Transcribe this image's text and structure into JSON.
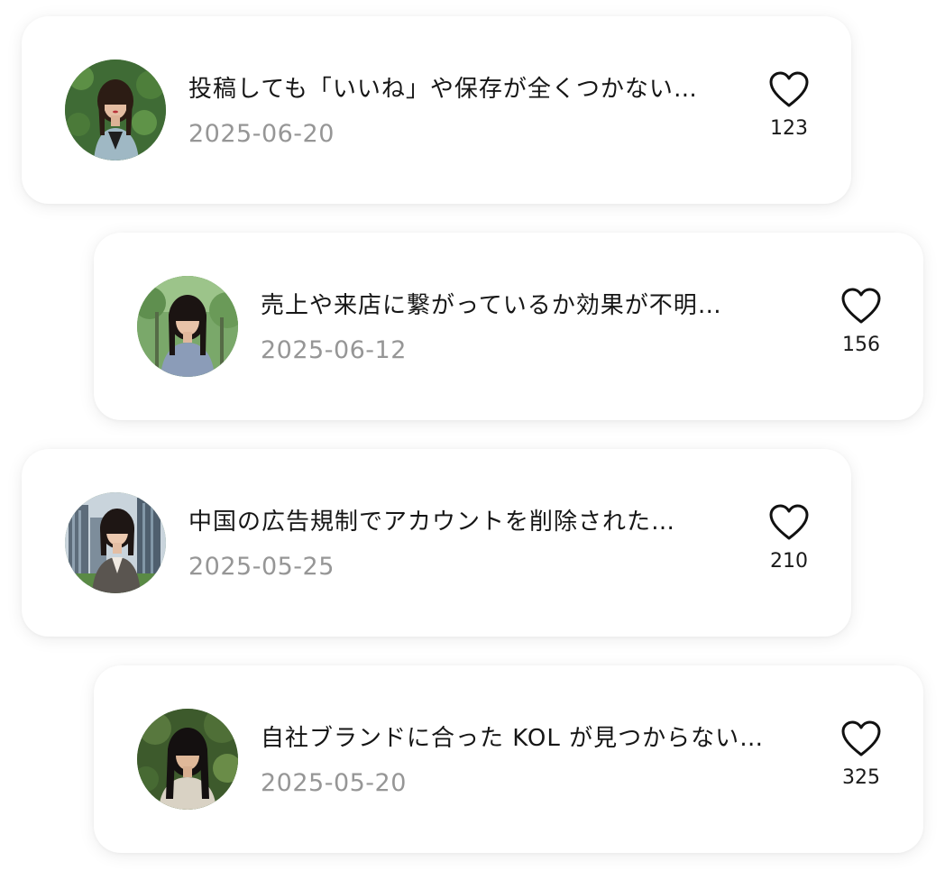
{
  "posts": [
    {
      "title": "投稿しても「いいね」や保存が全くつかない…",
      "date": "2025-06-20",
      "likes": "123",
      "avatar_icon": "user-photo-icon"
    },
    {
      "title": "売上や来店に繋がっているか効果が不明…",
      "date": "2025-06-12",
      "likes": "156",
      "avatar_icon": "user-photo-icon"
    },
    {
      "title": "中国の広告規制でアカウントを削除された…",
      "date": "2025-05-25",
      "likes": "210",
      "avatar_icon": "user-photo-icon"
    },
    {
      "title": "自社ブランドに合った KOL が見つからない…",
      "date": "2025-05-20",
      "likes": "325",
      "avatar_icon": "user-photo-icon"
    }
  ],
  "icons": {
    "like": "heart-icon"
  },
  "colors": {
    "title_text": "#161616",
    "date_text": "#969696",
    "card_background": "#ffffff"
  }
}
